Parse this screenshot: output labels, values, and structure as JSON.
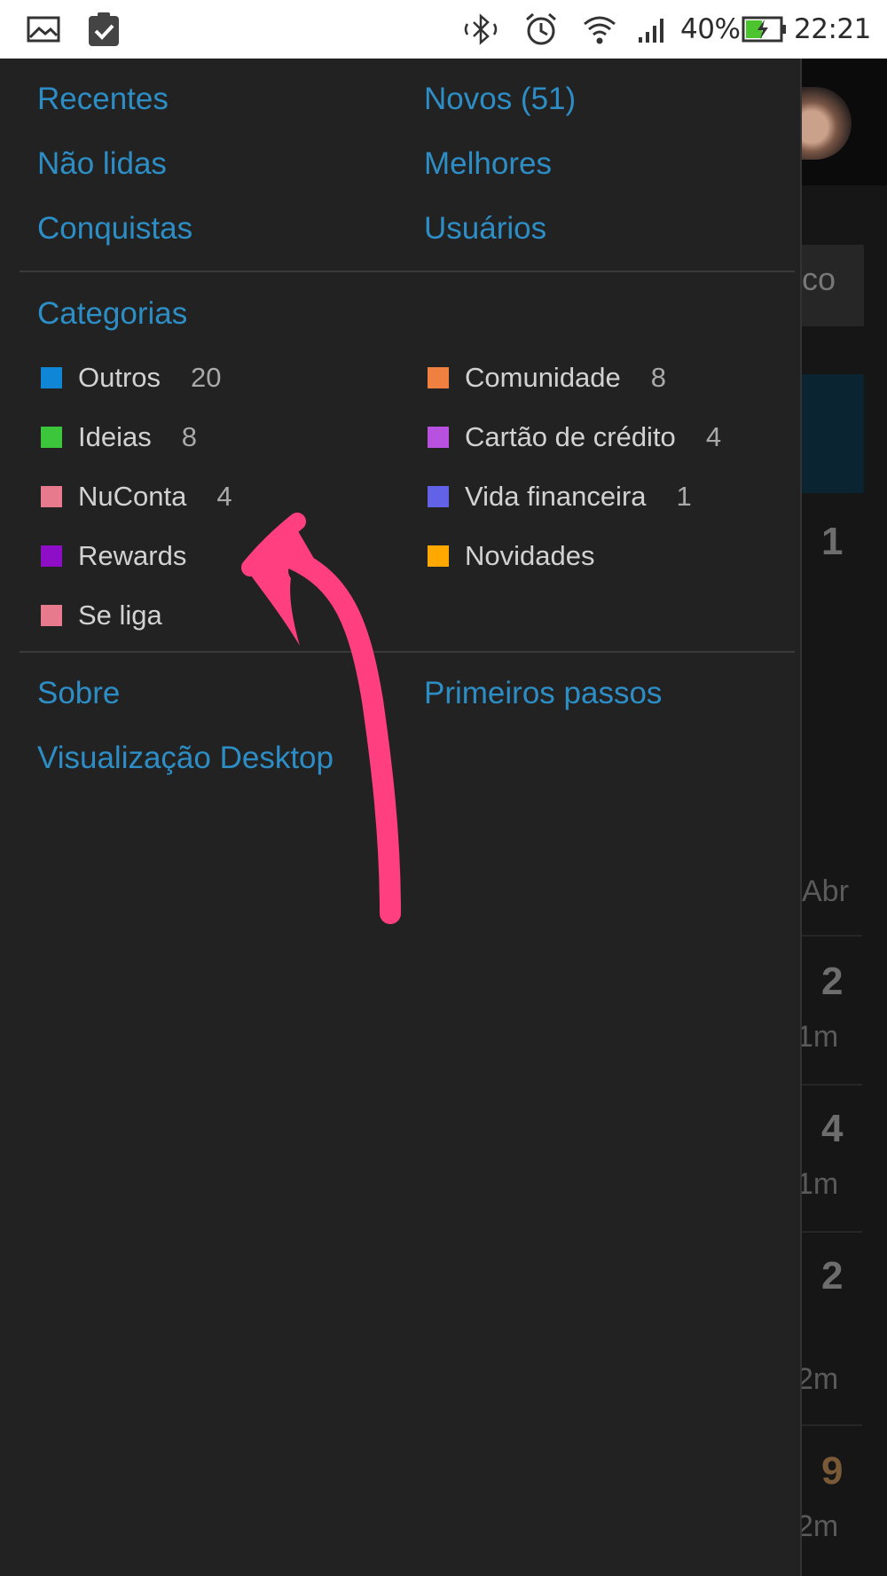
{
  "status_bar": {
    "battery": "40%",
    "time": "22:21",
    "icons": [
      "gallery-icon",
      "clipboard-check-icon",
      "bluetooth-icon",
      "alarm-icon",
      "wifi-icon",
      "signal-icon",
      "battery-charging-icon"
    ]
  },
  "drawer": {
    "nav": {
      "recentes": "Recentes",
      "novos": "Novos (51)",
      "nao_lidas": "Não lidas",
      "melhores": "Melhores",
      "conquistas": "Conquistas",
      "usuarios": "Usuários"
    },
    "categories_title": "Categorias",
    "categories": [
      {
        "name": "Outros",
        "count": "20",
        "color": "#0f86d6"
      },
      {
        "name": "Comunidade",
        "count": "8",
        "color": "#f08040"
      },
      {
        "name": "Ideias",
        "count": "8",
        "color": "#3cc63c"
      },
      {
        "name": "Cartão de crédito",
        "count": "4",
        "color": "#b850e0"
      },
      {
        "name": "NuConta",
        "count": "4",
        "color": "#e87a8e"
      },
      {
        "name": "Vida financeira",
        "count": "1",
        "color": "#6262e8"
      },
      {
        "name": "Rewards",
        "count": "",
        "color": "#8e0ec8"
      },
      {
        "name": "Novidades",
        "count": "",
        "color": "#ffa800"
      },
      {
        "name": "Se liga",
        "count": "",
        "color": "#e87a8e"
      }
    ],
    "footer": {
      "sobre": "Sobre",
      "primeiros_passos": "Primeiros passos",
      "visualizacao_desktop": "Visualização Desktop"
    }
  },
  "background": {
    "search_partial": "co",
    "topic_counts": [
      "1",
      "2",
      "4",
      "2",
      "9"
    ],
    "meta": [
      "Abr",
      "1m",
      "1m",
      "2m",
      "2m"
    ]
  },
  "annotation": {
    "color": "#ff3f7f"
  }
}
